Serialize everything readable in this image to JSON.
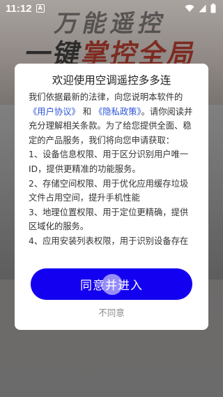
{
  "status_bar": {
    "time": "11:12",
    "notification_badge": "A",
    "icons": [
      "wifi-icon",
      "signal-icon",
      "battery-icon"
    ]
  },
  "background": {
    "slogan_top": "万能遥控",
    "slogan_main_a": "一键",
    "slogan_main_b": "掌控全局"
  },
  "dialog": {
    "title": "欢迎使用空调遥控多多连",
    "intro_before": "我们依据最新的法律，向您说明本软件的",
    "link_user_agreement": "《用户协议》",
    "and": "和",
    "link_privacy_policy": "《隐私政策》",
    "intro_after": "。请你阅读并充分理解相关条款。为了给您提供全面、稳定的产品服务，我们将向您申请获取：",
    "item1": "1、设备信息权限、用于区分识别用户唯一ID，提供更精准的功能服务。",
    "item2": "2、存储空间权限、用于优化应用缓存垃圾文件占用空间，提升手机性能",
    "item3": "3、地理位置权限、用于定位更精确，提供区域化的服务。",
    "item4": "4、应用安装列表权限，用于识别设备存在",
    "agree_button": "同意并进入",
    "disagree_link": "不同意"
  },
  "colors": {
    "accent_button": "#1400f0",
    "link": "#2b54d8",
    "disagree_text": "#8a8a8a"
  }
}
